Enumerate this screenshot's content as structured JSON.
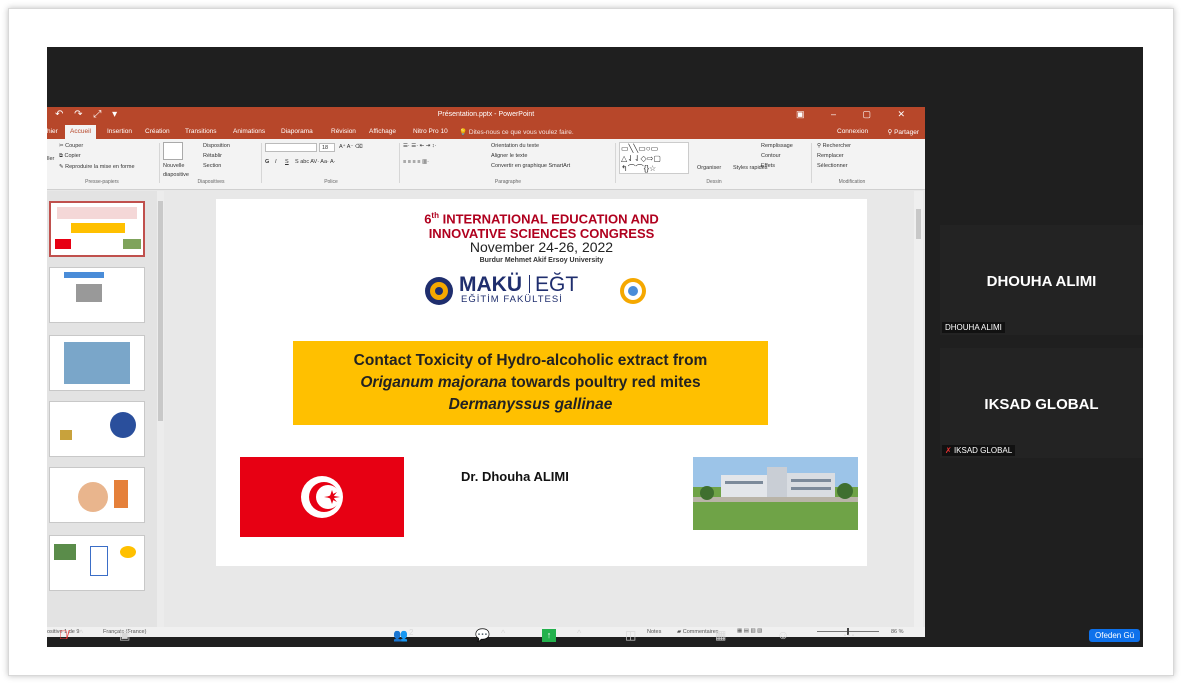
{
  "window": {
    "title": "Présentation.pptx - PowerPoint",
    "sign_in": "Connexion",
    "share": "Partager"
  },
  "ribbon_tabs": [
    "hier",
    "Accueil",
    "Insertion",
    "Création",
    "Transitions",
    "Animations",
    "Diaporama",
    "Révision",
    "Affichage",
    "Nitro Pro 10"
  ],
  "tell_me": "Dites-nous ce que vous voulez faire.",
  "ribbon": {
    "clipboard": {
      "cut": "Couper",
      "copy": "Copier",
      "format_painter": "Reproduire la mise en forme",
      "label": "Presse-papiers",
      "paste": "ller"
    },
    "slides": {
      "new_slide": "Nouvelle diapositive",
      "layout": "Disposition",
      "reset": "Rétablir",
      "section": "Section",
      "label": "Diapositives"
    },
    "font": {
      "size": "18",
      "bold": "G",
      "italic": "I",
      "underline": "S",
      "label": "Police"
    },
    "paragraph": {
      "text_direction": "Orientation du texte",
      "align_text": "Aligner le texte",
      "smartart": "Convertir en graphique SmartArt",
      "label": "Paragraphe"
    },
    "drawing": {
      "arrange": "Organiser",
      "quick_styles": "Styles rapides",
      "fill": "Remplissage",
      "outline": "Contour",
      "effects": "Effets",
      "label": "Dessin"
    },
    "editing": {
      "find": "Rechercher",
      "replace": "Remplacer",
      "select": "Sélectionner",
      "label": "Modification"
    }
  },
  "slide": {
    "conference_ordinal": "6",
    "conference_sup": "th",
    "conference_line1": "INTERNATIONAL EDUCATION AND",
    "conference_line2": "INNOVATIVE SCIENCES CONGRESS",
    "dates": "November 24-26, 2022",
    "university": "Burdur Mehmet Akif Ersoy University",
    "logo_main": "MAKÜ",
    "logo_side": "EĞT",
    "logo_sub": "EĞİTİM FAKÜLTESİ",
    "title_line1": "Contact Toxicity of Hydro-alcoholic extract from",
    "title_italic": "Origanum majorana",
    "title_line2_rest": " towards poultry red mites",
    "title_line3": "Dermanyssus gallinae",
    "author": "Dr. Dhouha ALIMI"
  },
  "status_bar": {
    "slide_info": "ositive 1 de 9",
    "language": "Français (France)",
    "notes": "Notes",
    "comments": "Commentaires",
    "zoom": "86 %"
  },
  "participants": [
    {
      "name": "DHOUHA ALIMI",
      "label": "DHOUHA ALIMI"
    },
    {
      "name": "IKSAD GLOBAL",
      "label": "IKSAD GLOBAL"
    }
  ],
  "toolbar": {
    "participants_count": "2",
    "badge": "Ofeden Gü"
  },
  "colors": {
    "ppt_accent": "#b7472a",
    "conference_red": "#b0001e",
    "title_box": "#ffc000",
    "tunisia_red": "#e70013",
    "zoom_bg": "#1f1f1f"
  }
}
